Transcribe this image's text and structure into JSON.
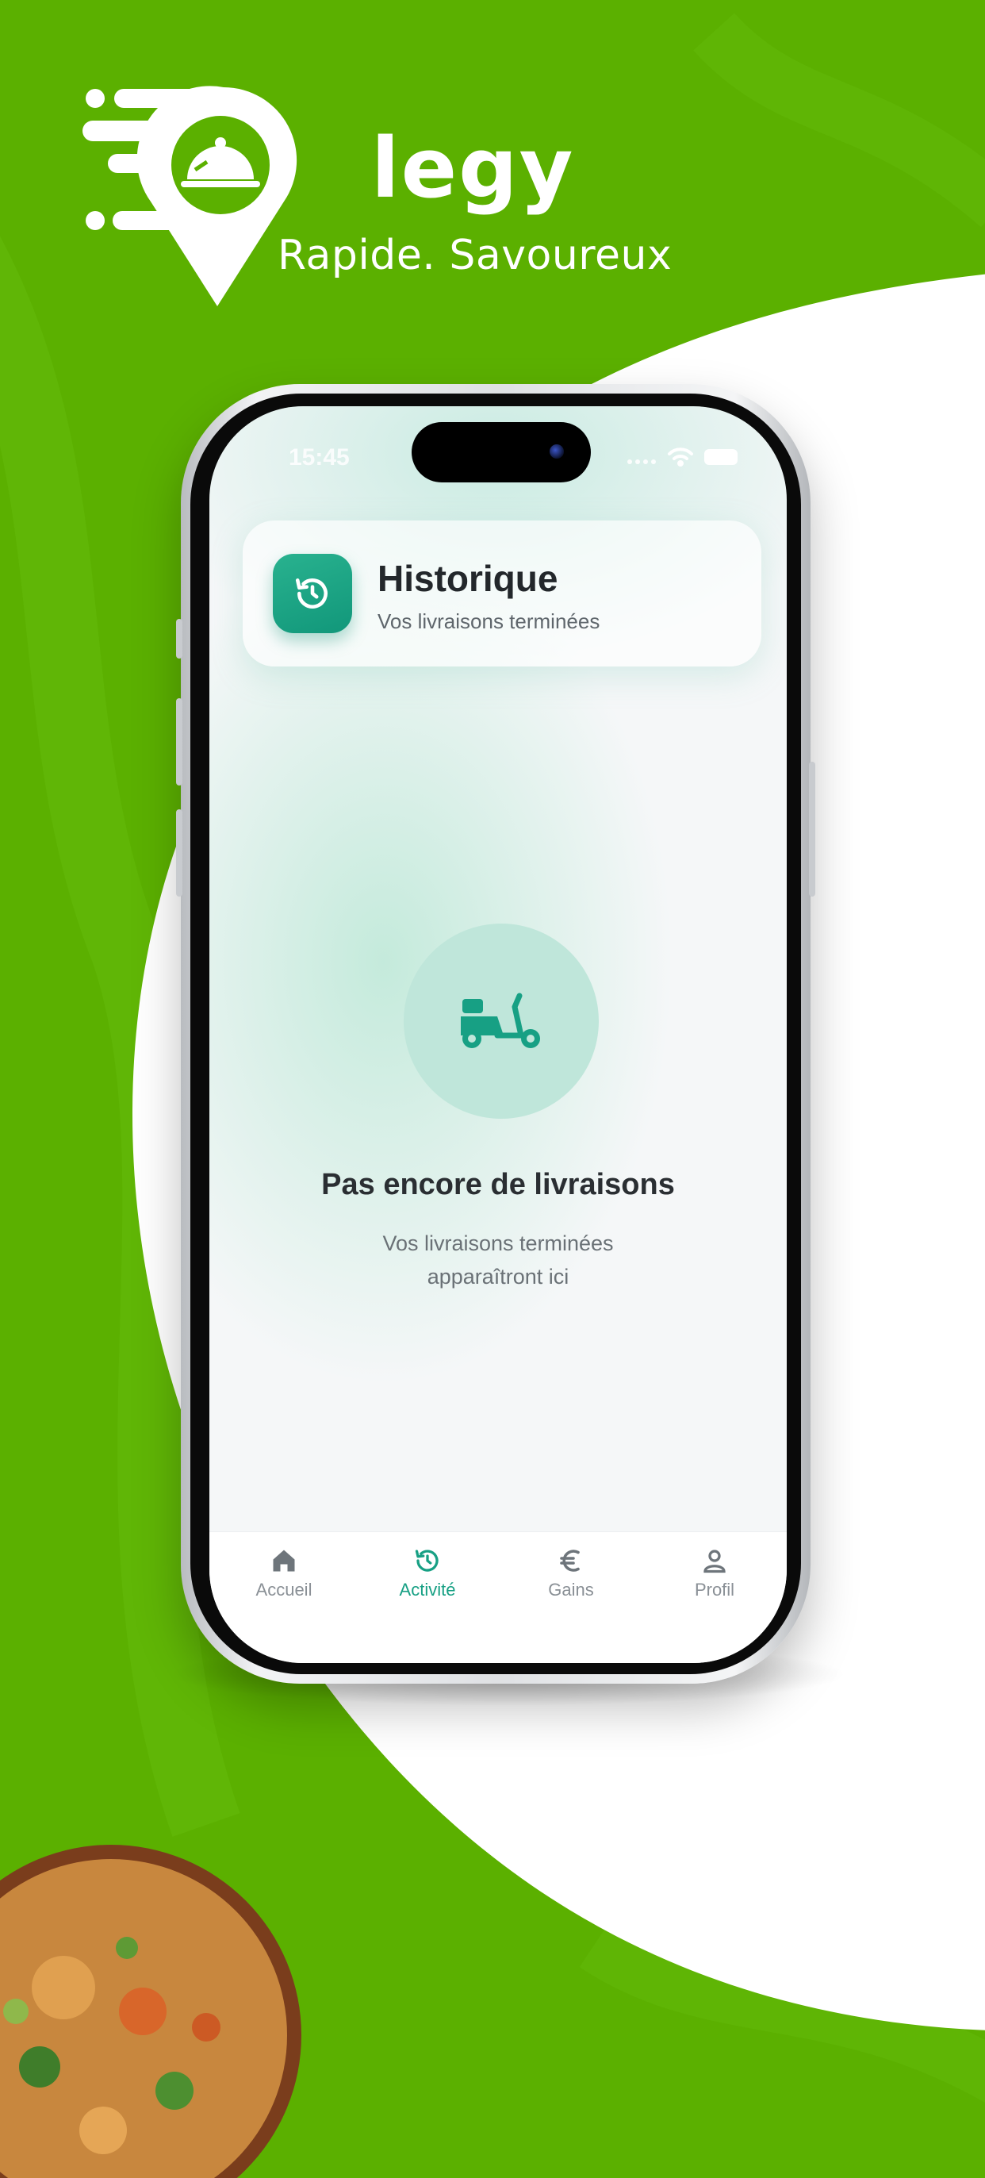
{
  "brand": {
    "name": "legy",
    "tagline": "Rapide. Savoureux"
  },
  "status_bar": {
    "time": "15:45"
  },
  "header": {
    "title": "Historique",
    "subtitle": "Vos livraisons terminées",
    "icon": "history-icon"
  },
  "empty_state": {
    "icon": "scooter-icon",
    "title": "Pas encore de livraisons",
    "description": "Vos livraisons terminées apparaîtront ici"
  },
  "tabs": [
    {
      "label": "Accueil",
      "icon": "home-icon",
      "active": false
    },
    {
      "label": "Activité",
      "icon": "history-icon",
      "active": true
    },
    {
      "label": "Gains",
      "icon": "euro-icon",
      "active": false
    },
    {
      "label": "Profil",
      "icon": "user-icon",
      "active": false
    }
  ],
  "colors": {
    "background_green": "#5bb000",
    "accent_teal": "#17a084",
    "empty_circle": "#bfe6da",
    "text_dark": "#2a2e32",
    "text_muted": "#6a7176"
  }
}
